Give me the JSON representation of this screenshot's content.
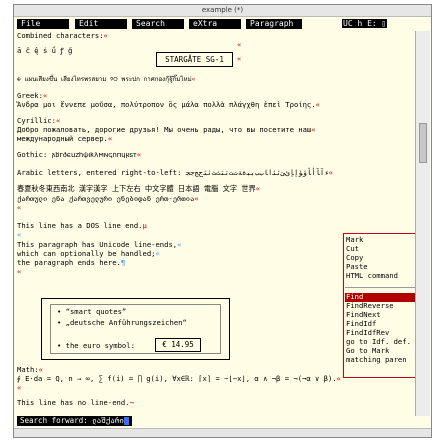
{
  "window": {
    "title": "example (*)"
  },
  "menu": {
    "file": "File",
    "edit": "Edit",
    "search": "Search",
    "extra": "eXtra",
    "paragraph": "Paragraph",
    "indicators": "UC h E: ▯"
  },
  "lines": [
    "Combined characters:",
    "ā ĉ ę̂ ṡ ǘ ꝭ g̋",
    "⊕ แผนเสียงขึ้น เสียงไทรพรสยาม ୨୦  พระปก กาศกองกุ๊จู๊กิ๊มไหม่",
    "Greek:",
    "Ἄνδρα μοι ἔννεπε μοῦσα, πολύτροπον ὃς μάλα πολλὰ πλάγχθη ἐπεὶ Τροίης.",
    "Cyrillic:",
    "Добро пожаловать, дорогие друзья! Мы очень рады, что вы посетите наш",
    "международный сервер.",
    "Gothic: 𐌰𐌱𐌲𐌳𐌴𐌵𐌶𐌷𐌸𐌹𐌺𐌻𐌼𐌽𐌾𐌿𐍀𐍁𐍂𐍃𐍄",
    "Arabic letters, entered right-to-left: ﺀﺁﺂﺃﺄﺅﺆﺇﺈﺉﺊﺋﺌﺍﺎﺏﺐﺑﺒﺓﺔﺕﺖﺗﺘﺙﺚﺛﺜﺝﺞﺟﺠ",
    "春夏秋冬東西南北 漢字漢字 上下左右 中文字體 日本語 電腦 文字 世界",
    "ქართული ენა ქართველური ენებიდან ერთ-ერთია",
    "This line has a DOS line end.",
    "This paragraph has Unicode line-ends,",
    "which can optionally be handled;",
    "the paragraph ends here.",
    "Math:",
    "∮ E⋅da = Q,  n → ∞, ∑ f(i) = ∏ g(i), ∀x∈ℝ: ⌈x⌉ = −⌊−x⌋, α ∧ ¬β = ¬(¬α ∨ β).",
    "This line has no line-end."
  ],
  "sg_label": "STARGÅTE SG-1",
  "box": {
    "item1": "“smart quotes”",
    "item2": "„deutsche Anführungszeichen“",
    "item3": "the euro symbol:",
    "price": "€ 14.95"
  },
  "popup_items": [
    "Mark",
    "Cut",
    "Copy",
    "Paste",
    "HTML command",
    "Find",
    "FindReverse",
    "FindNext",
    "FindIdf",
    "FindIdfRev",
    "go to Idf. def.",
    "Go to Mark",
    "matching paren"
  ],
  "status": {
    "search_label": "Search forward:",
    "search_value": "ლაშქარი"
  },
  "colors": {
    "background": "#fffde6",
    "eol_marker": "#d40000",
    "selection": "#b00000"
  }
}
